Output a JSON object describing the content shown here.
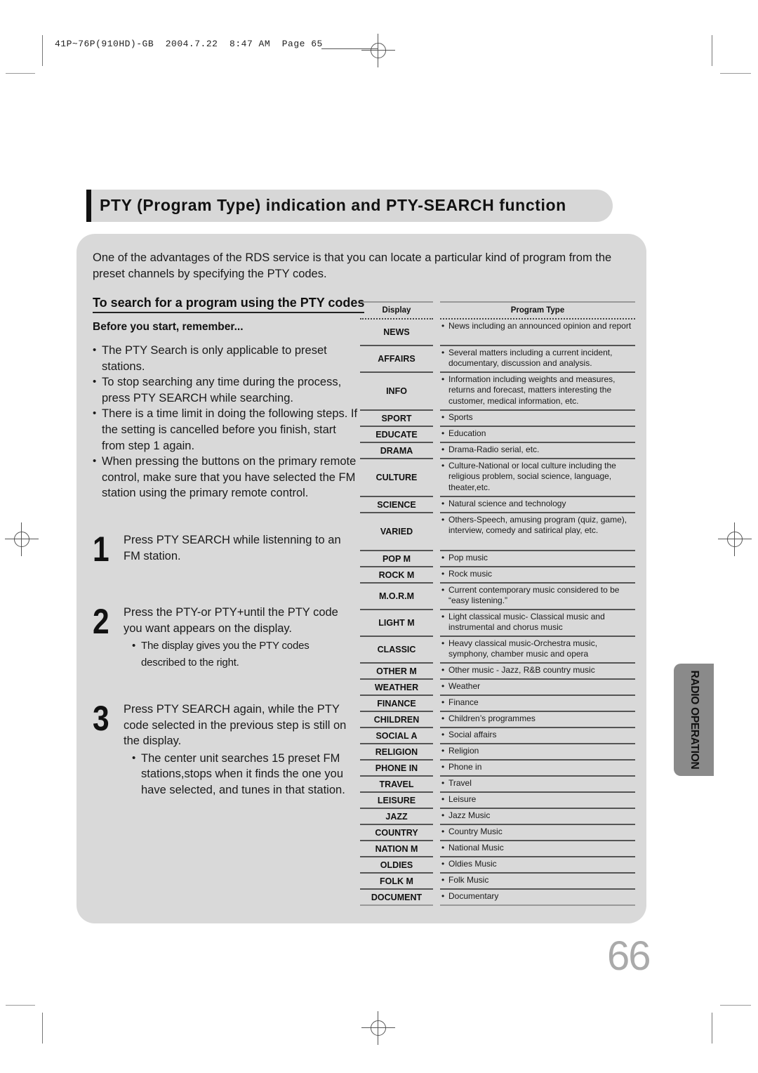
{
  "print_slug": "41P~76P(910HD)-GB  2004.7.22  8:47 AM  Page 65",
  "title": "PTY (Program Type) indication and PTY-SEARCH function",
  "intro": "One  of the advantages of the RDS service is that you can locate a particular kind of program from the preset channels by specifying the PTY codes.",
  "section": {
    "heading": "To search for a program using the PTY codes",
    "before_heading": "Before you start, remember...",
    "bullets": [
      "The PTY Search is only applicable to preset stations.",
      "To stop searching any time during the process, press PTY SEARCH while searching.",
      "There is a time limit in doing the following steps. If the setting is cancelled before you finish, start from step 1 again.",
      "When pressing the buttons on the primary remote control, make sure that you have selected the FM station using the primary remote control."
    ]
  },
  "steps": [
    {
      "number": "1",
      "text": "Press PTY SEARCH while listenning to an FM station.",
      "note": ""
    },
    {
      "number": "2",
      "text": "Press the PTY-or PTY+until the PTY code you want appears on the display.",
      "note": "The display gives you the PTY codes described to the right."
    },
    {
      "number": "3",
      "text": "Press PTY SEARCH again, while the PTY code selected in the previous step is still on the display.",
      "note": "The center unit searches 15 preset FM stations,stops when it finds the one you have selected, and tunes in that station."
    }
  ],
  "table": {
    "headers": {
      "display": "Display",
      "program_type": "Program Type"
    },
    "rows": [
      {
        "code": "NEWS",
        "desc": "News including an announced opinion and report"
      },
      {
        "code": "AFFAIRS",
        "desc": "Several matters including a current incident, documentary, discussion and analysis."
      },
      {
        "code": "INFO",
        "desc": "Information including weights and measures, returns and forecast, matters interesting the customer, medical information, etc."
      },
      {
        "code": "SPORT",
        "desc": "Sports"
      },
      {
        "code": "EDUCATE",
        "desc": "Education"
      },
      {
        "code": "DRAMA",
        "desc": "Drama-Radio serial, etc."
      },
      {
        "code": "CULTURE",
        "desc": "Culture-National or local culture including the religious problem, social science, language, theater,etc."
      },
      {
        "code": "SCIENCE",
        "desc": "Natural science and technology"
      },
      {
        "code": "VARIED",
        "desc": "Others-Speech, amusing program (quiz, game), interview, comedy and satirical play, etc."
      },
      {
        "code": "POP M",
        "desc": "Pop music"
      },
      {
        "code": "ROCK M",
        "desc": "Rock music"
      },
      {
        "code": "M.O.R.M",
        "desc": "Current contemporary music considered to be “easy listening.”"
      },
      {
        "code": "LIGHT M",
        "desc": "Light classical music- Classical music and instrumental and chorus music"
      },
      {
        "code": "CLASSIC",
        "desc": "Heavy classical  music-Orchestra music, symphony, chamber music and opera"
      },
      {
        "code": "OTHER M",
        "desc": "Other music - Jazz, R&B country music"
      },
      {
        "code": "WEATHER",
        "desc": "Weather"
      },
      {
        "code": "FINANCE",
        "desc": "Finance"
      },
      {
        "code": "CHILDREN",
        "desc": "Children’s programmes"
      },
      {
        "code": "SOCIAL A",
        "desc": "Social affairs"
      },
      {
        "code": "RELIGION",
        "desc": "Religion"
      },
      {
        "code": "PHONE IN",
        "desc": "Phone in"
      },
      {
        "code": "TRAVEL",
        "desc": "Travel"
      },
      {
        "code": "LEISURE",
        "desc": "Leisure"
      },
      {
        "code": "JAZZ",
        "desc": "Jazz Music"
      },
      {
        "code": "COUNTRY",
        "desc": "Country Music"
      },
      {
        "code": "NATION M",
        "desc": "National Music"
      },
      {
        "code": "OLDIES",
        "desc": "Oldies Music"
      },
      {
        "code": "FOLK M",
        "desc": "Folk Music"
      },
      {
        "code": "DOCUMENT",
        "desc": "Documentary"
      }
    ]
  },
  "side_tab": "RADIO OPERATION",
  "page_number": "66",
  "colors": {
    "panel": "#d9d9d9",
    "title_bar": "#d7d7d7",
    "side_tab": "#8a8a8a",
    "page_number": "#aaaaaa"
  }
}
